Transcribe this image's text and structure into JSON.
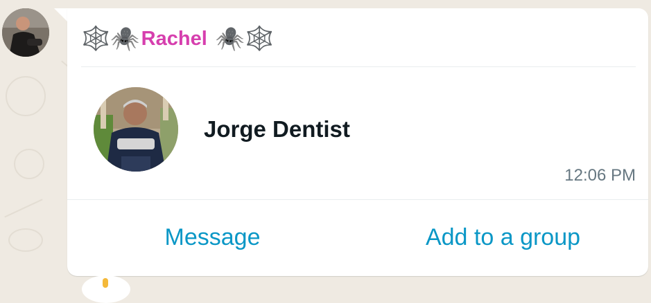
{
  "chat": {
    "sender": {
      "decoration_left": "🕸️🕷️",
      "name": "Rachel",
      "decoration_right": "🕷️🕸️",
      "name_color": "#d63fae"
    },
    "contact_card": {
      "name": "Jorge Dentist",
      "time": "12:06 PM",
      "actions": {
        "message": "Message",
        "add_to_group": "Add to a group"
      },
      "link_color": "#0a97c6"
    }
  },
  "icons": {
    "sender_avatar": "avatar-photo",
    "contact_avatar": "avatar-photo"
  }
}
